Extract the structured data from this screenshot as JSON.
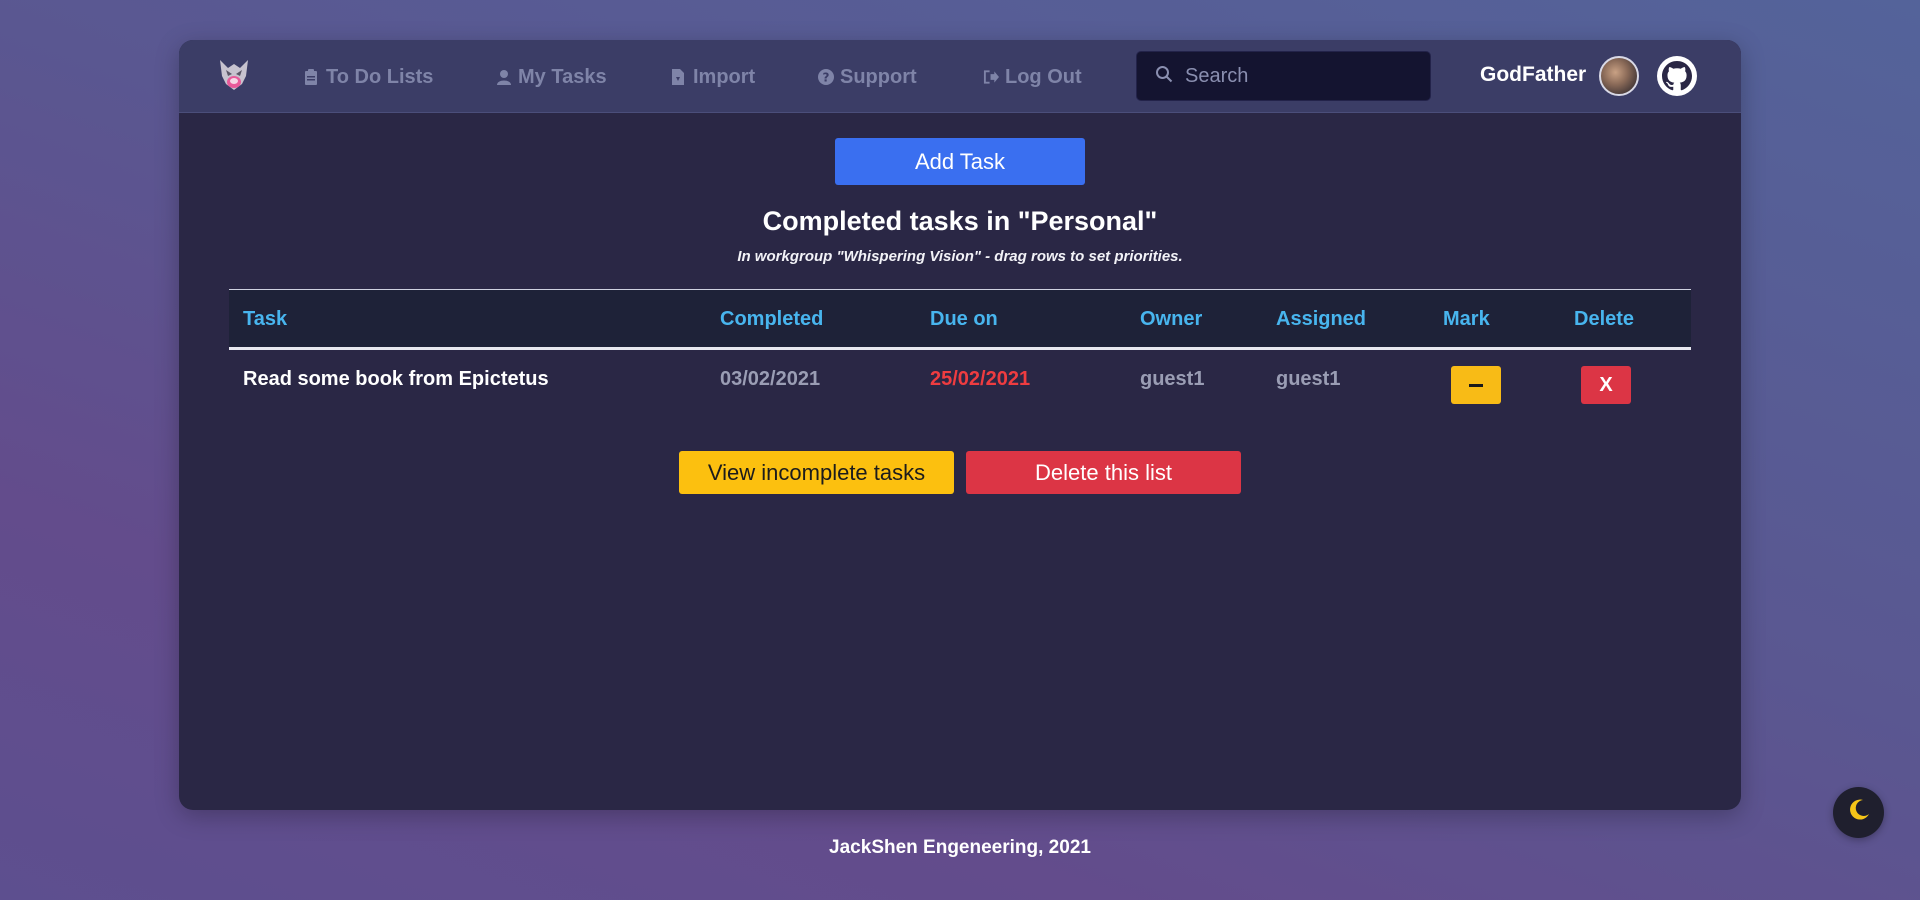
{
  "nav": {
    "items": [
      {
        "label": "To Do Lists",
        "icon": "clipboard-icon"
      },
      {
        "label": "My Tasks",
        "icon": "user-icon"
      },
      {
        "label": "Import",
        "icon": "file-icon"
      },
      {
        "label": "Support",
        "icon": "question-icon"
      },
      {
        "label": "Log Out",
        "icon": "logout-icon"
      }
    ],
    "search_placeholder": "Search",
    "username": "GodFather"
  },
  "main": {
    "add_task_label": "Add Task",
    "title": "Completed tasks in \"Personal\"",
    "subtitle": "In workgroup \"Whispering Vision\" - drag rows to set priorities.",
    "table": {
      "headers": [
        "Task",
        "Completed",
        "Due on",
        "Owner",
        "Assigned",
        "Mark",
        "Delete"
      ],
      "rows": [
        {
          "task": "Read some book from Epictetus",
          "completed": "03/02/2021",
          "due_on": "25/02/2021",
          "owner": "guest1",
          "assigned": "guest1",
          "delete_label": "X"
        }
      ]
    },
    "view_incomplete_label": "View incomplete tasks",
    "delete_list_label": "Delete this list"
  },
  "footer": {
    "text": "JackShen Engeneering, 2021"
  },
  "colors": {
    "accent_blue": "#3a6ff0",
    "warning_yellow": "#fcc00f",
    "danger_red": "#dc3545",
    "header_cyan": "#48b5ee",
    "overdue_red": "#ee3c40"
  }
}
